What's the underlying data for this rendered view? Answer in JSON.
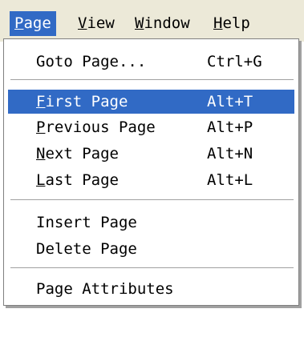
{
  "menubar": {
    "items": [
      {
        "first": "P",
        "rest": "age"
      },
      {
        "first": "V",
        "rest": "iew"
      },
      {
        "first": "W",
        "rest": "indow"
      },
      {
        "first": "H",
        "rest": "elp"
      }
    ]
  },
  "menu": {
    "goto": {
      "label": "Goto Page...",
      "shortcut": "Ctrl+G"
    },
    "first": {
      "mnemonic": "F",
      "rest": "irst Page",
      "shortcut": "Alt+T"
    },
    "previous": {
      "mnemonic": "P",
      "rest": "revious Page",
      "shortcut": "Alt+P"
    },
    "next": {
      "mnemonic": "N",
      "rest": "ext Page",
      "shortcut": "Alt+N"
    },
    "last": {
      "mnemonic": "L",
      "rest": "ast Page",
      "shortcut": "Alt+L"
    },
    "insert": {
      "label": "Insert Page"
    },
    "delete": {
      "label": "Delete Page"
    },
    "attributes": {
      "label": "Page Attributes"
    }
  },
  "colors": {
    "highlight": "#316ac5",
    "menubar_bg": "#ece9d8"
  }
}
